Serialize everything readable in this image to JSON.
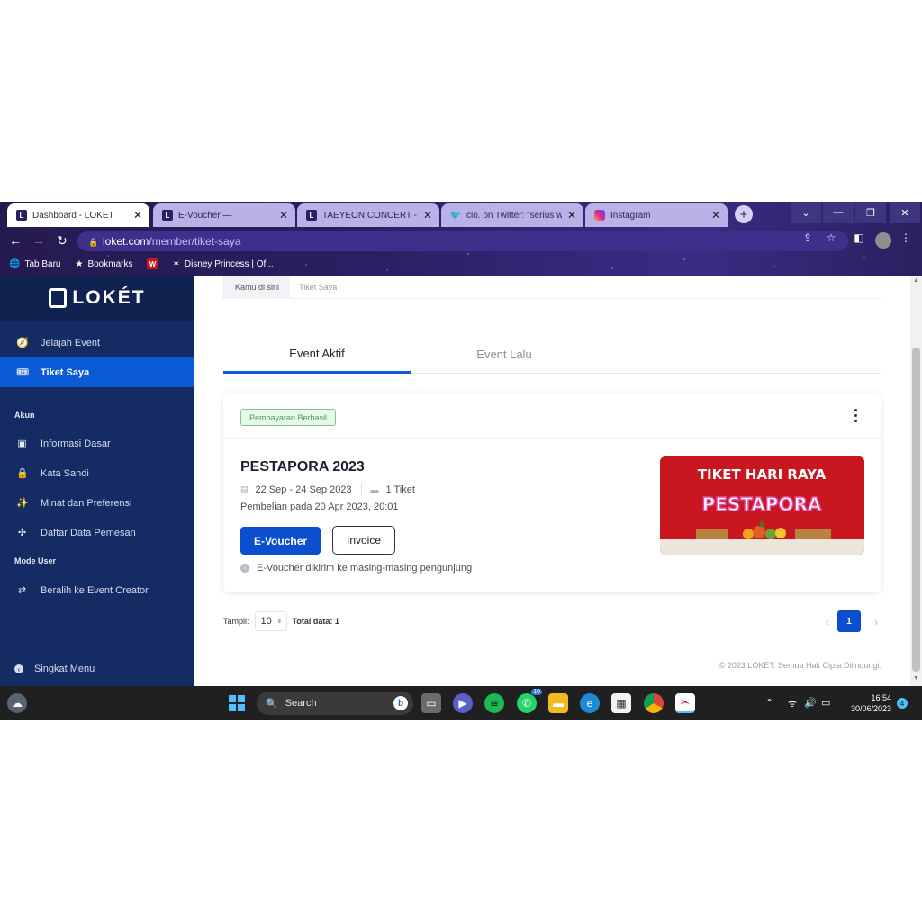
{
  "browser": {
    "tabs": [
      {
        "label": "Dashboard - LOKET",
        "favicon": "loket-icon"
      },
      {
        "label": "E-Voucher —",
        "favicon": "loket-icon"
      },
      {
        "label": "TAEYEON CONCERT - THE",
        "favicon": "loket-icon"
      },
      {
        "label": "cio. on Twitter: \"serius wtf",
        "favicon": "twitter-icon"
      },
      {
        "label": "Instagram",
        "favicon": "instagram-icon"
      }
    ],
    "url_host": "loket.com",
    "url_path": "/member/tiket-saya",
    "bookmarks": [
      {
        "label": "Tab Baru"
      },
      {
        "label": "Bookmarks"
      },
      {
        "label": "W"
      },
      {
        "label": "Disney Princess | Of..."
      }
    ]
  },
  "sidebar": {
    "logo_text": "LOKÉT",
    "items": [
      {
        "label": "Jelajah Event",
        "icon": "compass-icon"
      },
      {
        "label": "Tiket Saya",
        "icon": "ticket-icon"
      }
    ],
    "section_akun": "Akun",
    "akun_items": [
      {
        "label": "Informasi Dasar",
        "icon": "id-card-icon"
      },
      {
        "label": "Kata Sandi",
        "icon": "lock-icon"
      },
      {
        "label": "Minat dan Preferensi",
        "icon": "sparkle-icon"
      },
      {
        "label": "Daftar Data Pemesan",
        "icon": "users-icon"
      }
    ],
    "section_mode": "Mode User",
    "mode_items": [
      {
        "label": "Beralih ke Event Creator",
        "icon": "switch-icon"
      }
    ],
    "collapse_label": "Singkat Menu"
  },
  "main": {
    "breadcrumb": {
      "prefix": "Kamu di sini",
      "current": "Tiket Saya"
    },
    "tabs": [
      {
        "label": "Event Aktif",
        "active": true
      },
      {
        "label": "Event Lalu",
        "active": false
      }
    ],
    "ticket": {
      "status": "Pembayaran Berhasil",
      "title": "PESTAPORA 2023",
      "date_range": "22 Sep - 24 Sep 2023",
      "quantity": "1 Tiket",
      "purchase": "Pembelian pada 20 Apr 2023, 20:01",
      "evoucher_label": "E-Voucher",
      "invoice_label": "Invoice",
      "info": "E-Voucher dikirim ke masing-masing pengunjung",
      "banner_line1": "TIKET HARI RAYA",
      "banner_line2": "PESTAPORA"
    },
    "pagination": {
      "show_label": "Tampil:",
      "page_size": "10",
      "total_label": "Total data: 1",
      "current_page": "1"
    },
    "footer": "© 2023 LOKET. Semua Hak Cipta Dilindungi."
  },
  "taskbar": {
    "search_label": "Search",
    "whatsapp_badge": "10",
    "time": "16:54",
    "date": "30/06/2023",
    "notification_count": "4"
  },
  "colors": {
    "sidebar_bg": "#152b63",
    "accent": "#0b5bd6",
    "success": "#3e9b57",
    "banner": "#c8171e"
  }
}
